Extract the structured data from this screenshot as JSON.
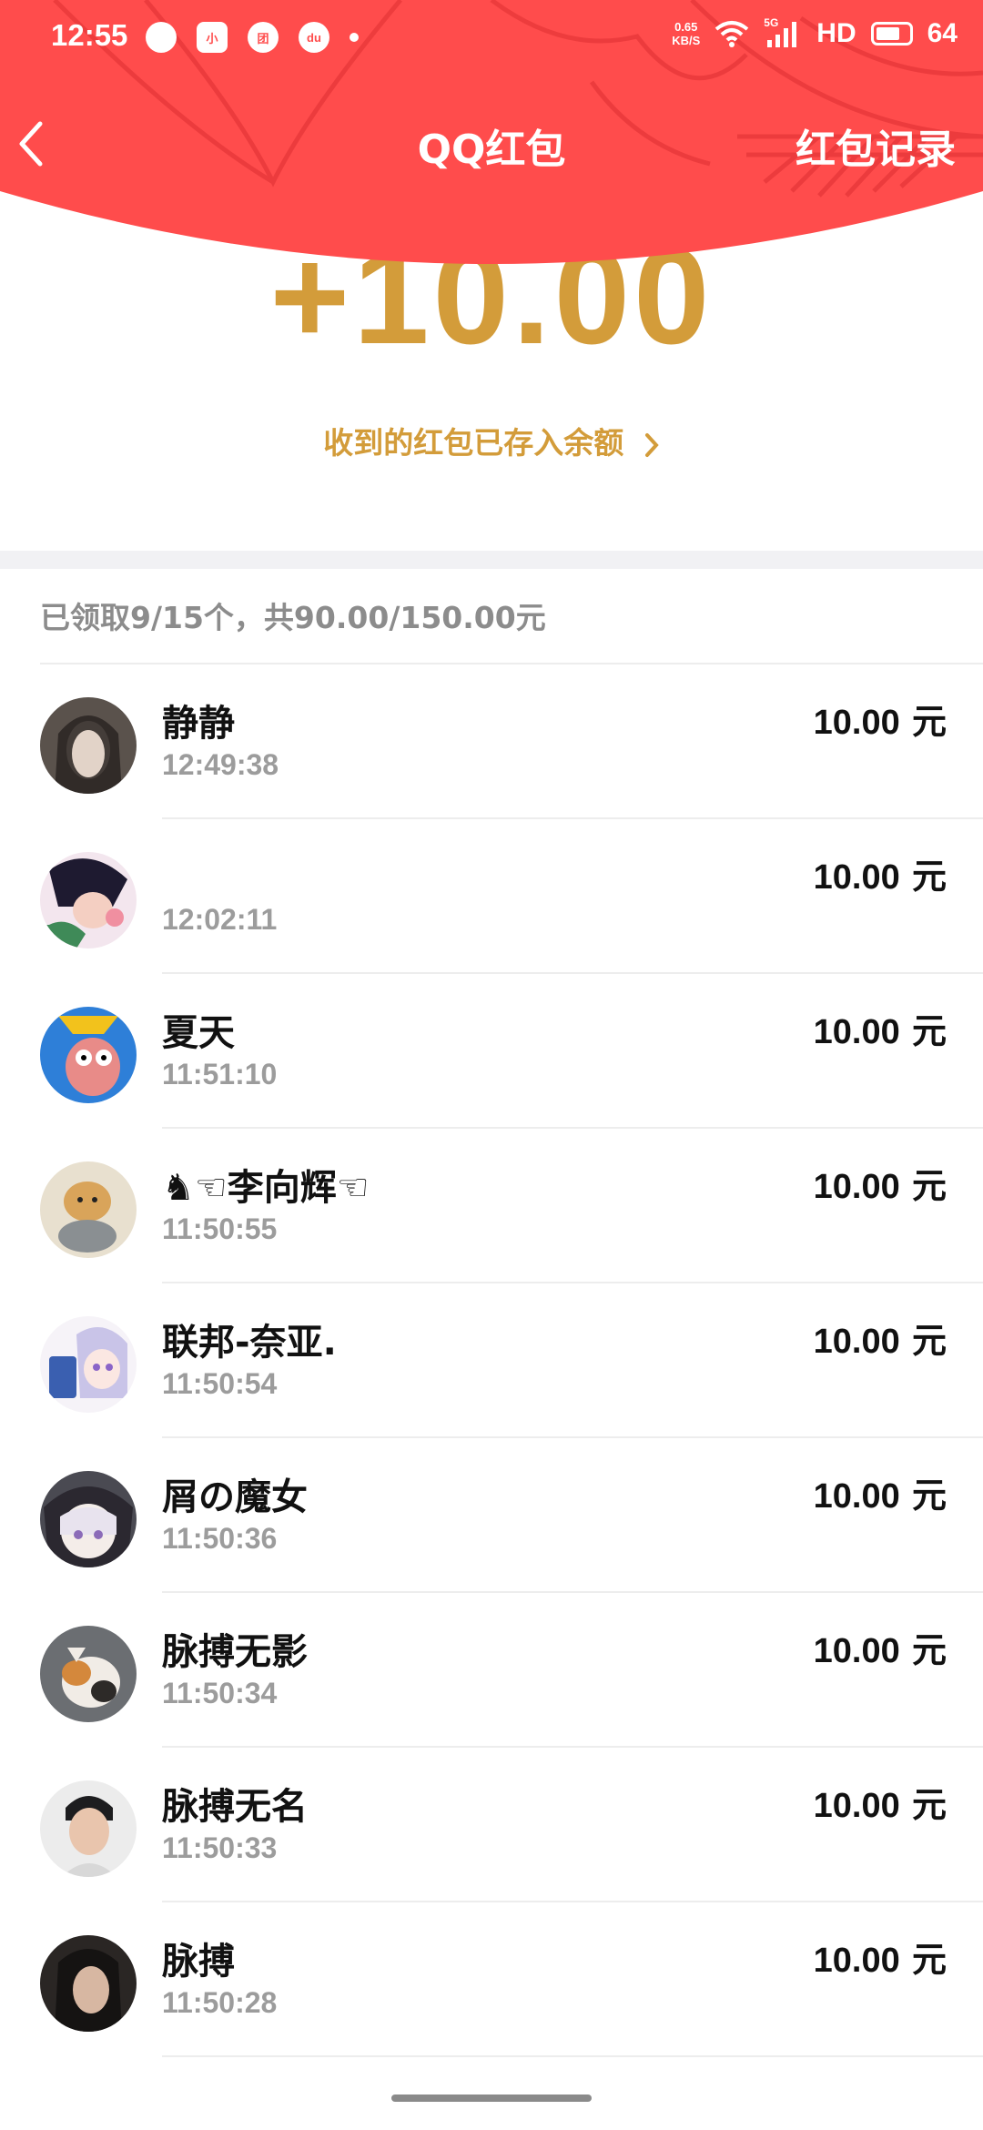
{
  "status_bar": {
    "time": "12:55",
    "app_icons": [
      "chat-bubble-icon",
      "notes-app-icon",
      "meituan-icon",
      "du-map-icon"
    ],
    "net_speed_value": "0.65",
    "net_speed_unit": "KB/S",
    "signal_label": "5G",
    "hd_label": "HD",
    "battery_level": "64"
  },
  "nav": {
    "title": "QQ红包",
    "right_label": "红包记录"
  },
  "amount": "+10.00",
  "balance_link": "收到的红包已存入余额",
  "summary": "已领取9/15个，共90.00/150.00元",
  "colors": {
    "header_red": "#ff4c4c",
    "gold": "#d39c3a"
  },
  "records": [
    {
      "name": "静静",
      "time": "12:49:38",
      "amount": "10.00",
      "unit": "元"
    },
    {
      "name": "",
      "time": "12:02:11",
      "amount": "10.00",
      "unit": "元"
    },
    {
      "name": "夏天",
      "time": "11:51:10",
      "amount": "10.00",
      "unit": "元"
    },
    {
      "name": "♞☜李向辉☜",
      "time": "11:50:55",
      "amount": "10.00",
      "unit": "元"
    },
    {
      "name": "联邦-奈亚.",
      "time": "11:50:54",
      "amount": "10.00",
      "unit": "元"
    },
    {
      "name": "屑の魔女",
      "time": "11:50:36",
      "amount": "10.00",
      "unit": "元"
    },
    {
      "name": "脉搏无影",
      "time": "11:50:34",
      "amount": "10.00",
      "unit": "元"
    },
    {
      "name": "脉搏无名",
      "time": "11:50:33",
      "amount": "10.00",
      "unit": "元"
    },
    {
      "name": "脉搏",
      "time": "11:50:28",
      "amount": "10.00",
      "unit": "元"
    }
  ]
}
